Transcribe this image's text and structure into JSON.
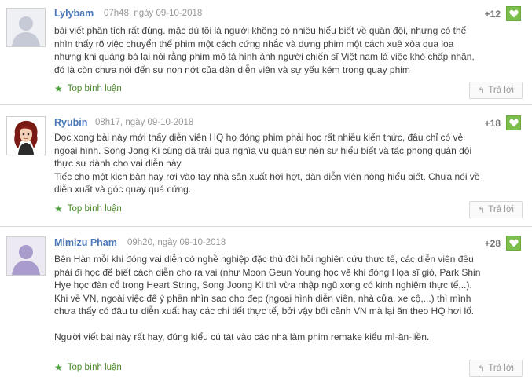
{
  "comments": [
    {
      "author": "Lylybam",
      "time": "07h48, ngày 09-10-2018",
      "score": "+12",
      "avatar": "default-avatar",
      "paragraphs": [
        "bài viết phân tích rất đúng. mặc dù tôi là người không có nhiều hiểu biết về quân đội, nhưng có thể nhìn thấy rõ việc chuyển thể phim một cách cứng nhắc và dựng phim một cách xuề xòa qua loa nhưng khi quảng bá lại nói rằng phim mô tả hình ảnh người chiến sĩ Việt nam là việc khó chấp nhận, đó là còn chưa nói đến sự non nớt của dàn diễn viên và sự yếu kém trong quay phim"
      ],
      "top_label": "Top bình luận",
      "reply_label": "Trả lời"
    },
    {
      "author": "Ryubin",
      "time": "08h17, ngày 09-10-2018",
      "score": "+18",
      "avatar": "anime-avatar",
      "paragraphs": [
        "Đọc xong bài này mới thấy diễn viên HQ họ đóng phim phải học rất nhiều kiến thức, đâu chỉ có vẻ ngoại hình. Song Jong Ki cũng đã trải qua nghĩa vụ quân sự nên sự hiểu biết và tác phong quân đội thực sự dành cho vai diễn này.",
        "Tiếc cho một kịch bản hay rơi vào tay nhà sản xuất hời hợt, dàn diễn viên nông hiểu biết. Chưa nói về diễn xuất và góc quay quá cứng."
      ],
      "top_label": "Top bình luận",
      "reply_label": "Trả lời"
    },
    {
      "author": "Mimizu Pham",
      "time": "09h20, ngày 09-10-2018",
      "score": "+28",
      "avatar": "default-avatar-purple",
      "paragraphs": [
        "Bên Hàn mỗi khi đóng vai diễn có nghề nghiệp đặc thù đòi hỏi nghiên cứu thực tế, các diễn viên đều phải đi học để biết cách diễn cho ra vai (như Moon Geun Young học vẽ khi đóng Họa sĩ gió, Park Shin Hye học đàn cổ trong Heart String, Song Joong Ki thì vừa nhập ngũ xong có kinh nghiệm thực tế,..). Khi về VN, ngoài việc để ý phần nhìn sao cho đẹp (ngoại hình diễn viên, nhà cửa, xe cộ,...) thì mình chưa thấy có đâu tư diễn xuất hay các chi tiết thực tế, bởi vậy bối cảnh VN mà lại ăn theo HQ hơi lố.",
        "Người viết bài này rất hay, đúng kiểu cú tát vào các nhà làm phim remake kiểu mì-ăn-liền."
      ],
      "top_label": "Top bình luận",
      "reply_label": "Trả lời"
    }
  ],
  "colors": {
    "author": "#4a76b8",
    "like": "#7cbf4d",
    "top": "#4a8a2a"
  }
}
